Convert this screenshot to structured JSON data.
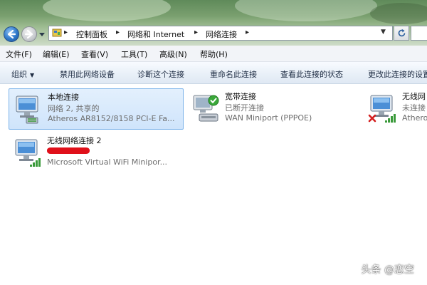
{
  "address": {
    "crumbs": [
      "控制面板",
      "网络和 Internet",
      "网络连接"
    ],
    "separator": "▸"
  },
  "menu": {
    "items": [
      "文件(F)",
      "编辑(E)",
      "查看(V)",
      "工具(T)",
      "高级(N)",
      "帮助(H)"
    ]
  },
  "commands": {
    "items": [
      "组织",
      "禁用此网络设备",
      "诊断这个连接",
      "重命名此连接",
      "查看此连接的状态",
      "更改此连接的设置"
    ]
  },
  "connections": [
    {
      "name": "本地连接",
      "status": "网络 2, 共享的",
      "device": "Atheros AR8152/8158 PCI-E Fa...",
      "icon": "ethernet-computer-icon",
      "selected": true
    },
    {
      "name": "宽带连接",
      "status": "已断开连接",
      "device": "WAN Miniport (PPPOE)",
      "icon": "broadband-modem-icon"
    },
    {
      "name": "无线网",
      "status": "未连接",
      "device": "Athero",
      "icon": "wireless-disconnected-icon"
    },
    {
      "name": "无线网络连接 2",
      "status": "",
      "device": "Microsoft Virtual WiFi Minipor...",
      "icon": "wireless-computer-icon",
      "status_redacted": true
    }
  ],
  "watermark": "头条 @恋空",
  "colors": {
    "selection_fill": "#cfe4fb",
    "selection_border": "#7eb4ea",
    "redaction": "#e0101a",
    "check_green": "#3aa83a",
    "error_red": "#d42020"
  }
}
